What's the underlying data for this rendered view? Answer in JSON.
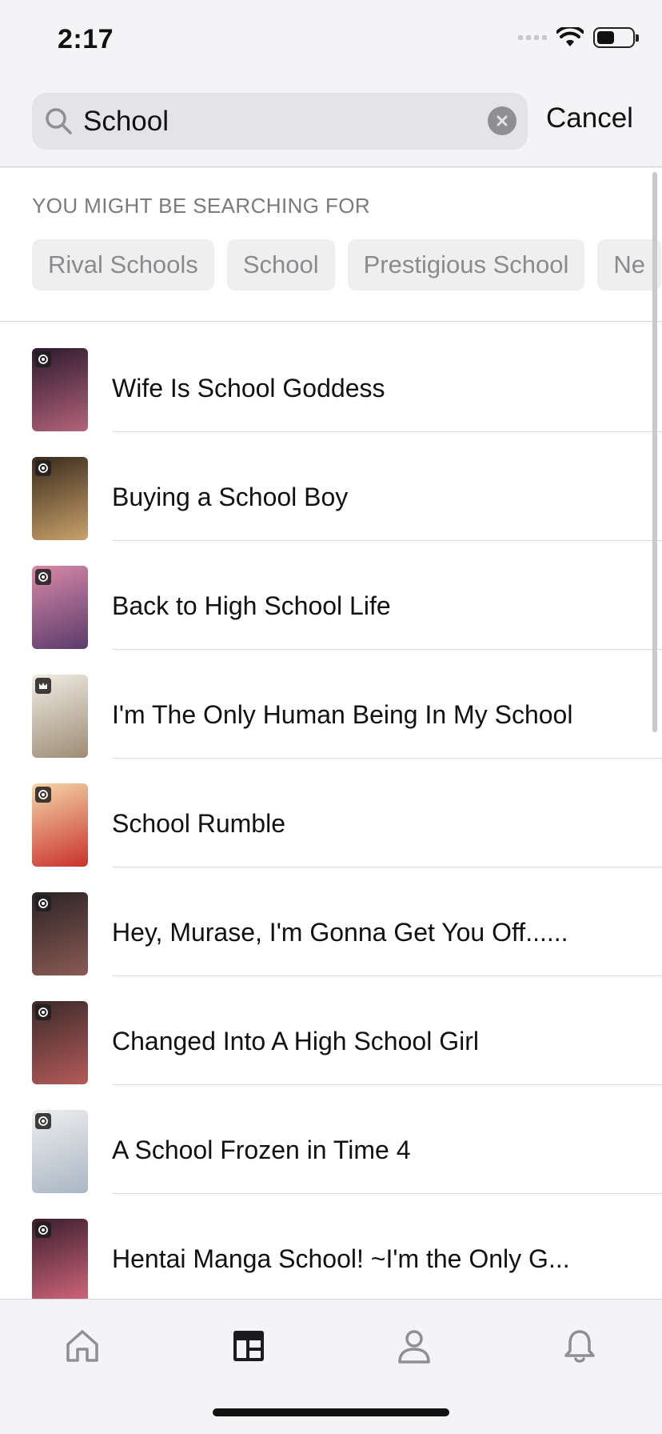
{
  "status_bar": {
    "time": "2:17",
    "battery_level": 0.5
  },
  "search": {
    "query": "School",
    "cancel_label": "Cancel",
    "icon": "search-icon",
    "clear_icon": "clear-icon"
  },
  "suggestions": {
    "title": "YOU MIGHT BE SEARCHING FOR",
    "chips": [
      "Rival Schools",
      "School",
      "Prestigious School",
      "Ne"
    ]
  },
  "results": [
    {
      "title": "Wife Is School Goddess",
      "badge": "eye-icon",
      "cover_colors": [
        "#2b1a2e",
        "#b5637a"
      ]
    },
    {
      "title": "Buying a School Boy",
      "badge": "eye-icon",
      "cover_colors": [
        "#3a2a1c",
        "#c9a26b"
      ]
    },
    {
      "title": "Back to High School Life",
      "badge": "eye-icon",
      "cover_colors": [
        "#d889a8",
        "#5a3b6b"
      ]
    },
    {
      "title": "I'm The Only Human Being In My School",
      "badge": "crown-icon",
      "cover_colors": [
        "#f1ece4",
        "#9c8c74"
      ]
    },
    {
      "title": "School Rumble",
      "badge": "eye-icon",
      "cover_colors": [
        "#f5d7a8",
        "#c8312d"
      ]
    },
    {
      "title": "Hey, Murase, I'm Gonna Get You Off......",
      "badge": "eye-icon",
      "cover_colors": [
        "#2a2424",
        "#8b5a55"
      ]
    },
    {
      "title": "Changed Into A High School Girl",
      "badge": "eye-icon",
      "cover_colors": [
        "#3b2a2a",
        "#b45b59"
      ]
    },
    {
      "title": "A School Frozen in Time 4",
      "badge": "eye-icon",
      "cover_colors": [
        "#eeeeee",
        "#a9b6c4"
      ]
    },
    {
      "title": "Hentai Manga School! ~I'm the Only G...",
      "badge": "eye-icon",
      "cover_colors": [
        "#3a1e2e",
        "#d2677b"
      ]
    }
  ],
  "tabbar": {
    "tabs": [
      {
        "icon": "home-icon",
        "active": false
      },
      {
        "icon": "library-icon",
        "active": true
      },
      {
        "icon": "profile-icon",
        "active": false
      },
      {
        "icon": "bell-icon",
        "active": false
      }
    ]
  }
}
